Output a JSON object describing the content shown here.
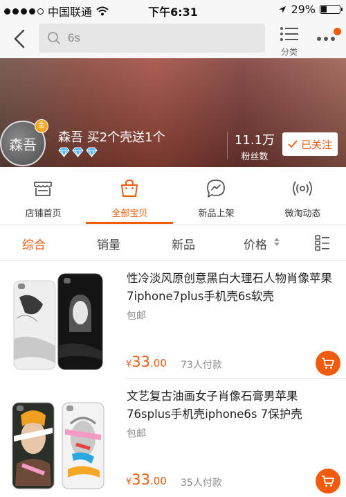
{
  "status_bar": {
    "carrier": "中国联通",
    "time": "下午6:31",
    "battery": "29%",
    "battery_level": 0.29
  },
  "nav": {
    "search_value": "6s",
    "category_label": "分类"
  },
  "shop": {
    "avatar_text": "森吾",
    "gold_badge": "金",
    "name": "森吾 买2个壳送1个",
    "fans_count": "11.1万",
    "fans_label": "粉丝数",
    "follow_label": "已关注"
  },
  "shop_tabs": [
    {
      "label": "店铺首页",
      "icon": "store-icon"
    },
    {
      "label": "全部宝贝",
      "icon": "shopping-bag-icon",
      "active": true
    },
    {
      "label": "新品上架",
      "icon": "new-arrival-icon"
    },
    {
      "label": "微淘动态",
      "icon": "broadcast-icon"
    }
  ],
  "sort": {
    "comprehensive": "综合",
    "sales": "销量",
    "new": "新品",
    "price": "价格"
  },
  "products": [
    {
      "title": "性冷淡风原创意黑白大理石人物肖像苹果7iphone7plus手机壳6s软壳",
      "shipping": "包邮",
      "currency": "¥",
      "price_int": "33",
      "price_dec": ".00",
      "paid": "73人付款"
    },
    {
      "title": "文艺复古油画女子肖像石膏男苹果76splus手机壳iphone6s 7保护壳",
      "shipping": "包邮",
      "currency": "¥",
      "price_int": "33",
      "price_dec": ".00",
      "paid": "35人付款"
    }
  ],
  "colors": {
    "accent": "#f25a0c"
  }
}
